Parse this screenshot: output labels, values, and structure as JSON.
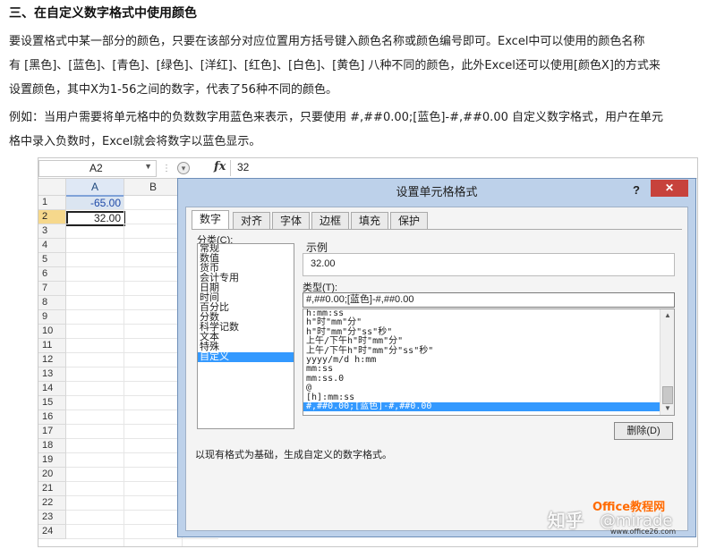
{
  "article": {
    "heading": "三、在自定义数字格式中使用颜色",
    "para1_lines": [
      "要设置格式中某一部分的颜色，只要在该部分对应位置用方括号键入颜色名称或颜色编号即可。Excel中可以使用的颜色名称",
      "有 [黑色]、[蓝色]、[青色]、[绿色]、[洋红]、[红色]、[白色]、[黄色] 八种不同的颜色，此外Excel还可以使用[颜色X]的方式来",
      "设置颜色，其中X为1-56之间的数字，代表了56种不同的颜色。"
    ],
    "para2_lines": [
      "例如：当用户需要将单元格中的负数数字用蓝色来表示，只要使用 #,##0.00;[蓝色]-#,##0.00 自定义数字格式，用户在单元",
      "格中录入负数时，Excel就会将数字以蓝色显示。"
    ]
  },
  "excel": {
    "name_box": "A2",
    "fx_label": "fx",
    "formula_value": "32",
    "columns": [
      "A",
      "B"
    ],
    "rows": [
      "1",
      "2",
      "3",
      "4",
      "5",
      "6",
      "7",
      "8",
      "9",
      "10",
      "11",
      "12",
      "13",
      "14",
      "15",
      "16",
      "17",
      "18",
      "19",
      "20",
      "21",
      "22",
      "23",
      "24"
    ],
    "cells": {
      "A1": "-65.00",
      "A2": "32.00"
    },
    "colors": {
      "negative_blue": "#1f4aa8",
      "selected_row_header": "#f6d88c"
    }
  },
  "dialog": {
    "title": "设置单元格格式",
    "help": "?",
    "close": "✕",
    "tabs": [
      "数字",
      "对齐",
      "字体",
      "边框",
      "填充",
      "保护"
    ],
    "category_label": "分类(C):",
    "categories": [
      "常规",
      "数值",
      "货币",
      "会计专用",
      "日期",
      "时间",
      "百分比",
      "分数",
      "科学记数",
      "文本",
      "特殊",
      "自定义"
    ],
    "selected_category": "自定义",
    "sample_label": "示例",
    "sample_value": "32.00",
    "type_label": "类型(T):",
    "type_value": "#,##0.00;[蓝色]-#,##0.00",
    "formats": [
      "h:mm:ss",
      "h\"时\"mm\"分\"",
      "h\"时\"mm\"分\"ss\"秒\"",
      "上午/下午h\"时\"mm\"分\"",
      "上午/下午h\"时\"mm\"分\"ss\"秒\"",
      "yyyy/m/d h:mm",
      "mm:ss",
      "mm:ss.0",
      "@",
      "[h]:mm:ss",
      "#,##0.00;[蓝色]-#,##0.00"
    ],
    "selected_format": "#,##0.00;[蓝色]-#,##0.00",
    "delete_button": "删除(D)",
    "description": "以现有格式为基础，生成自定义的数字格式。",
    "colors": {
      "selection": "#3399ff",
      "close_button": "#c7423c",
      "frame": "#bdd1ea"
    }
  },
  "watermark": {
    "zhihu": "知乎",
    "author": "@mirade",
    "brand": "Office教程网",
    "site": "www.office26.com"
  }
}
